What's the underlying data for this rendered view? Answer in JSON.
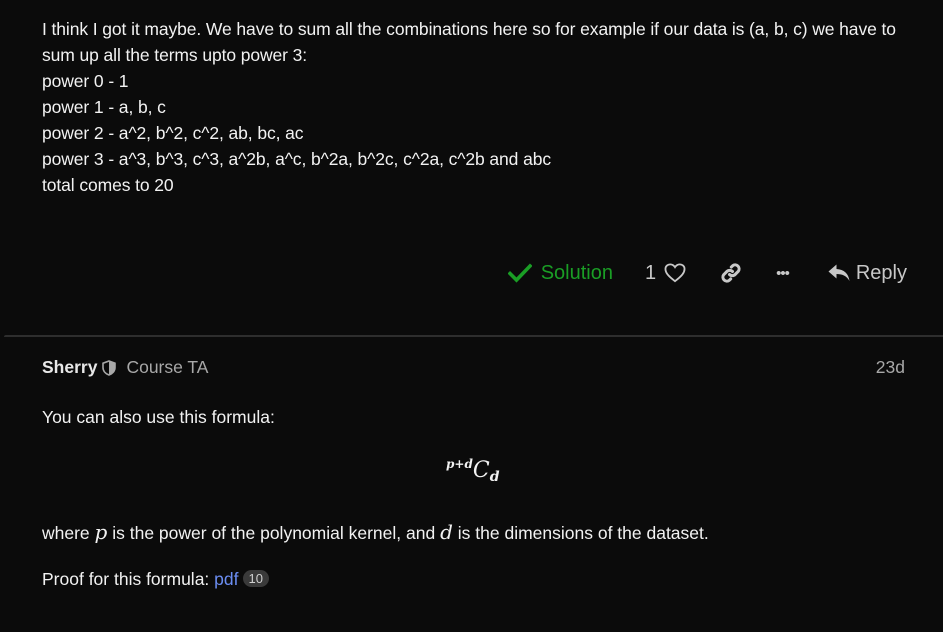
{
  "post1": {
    "lines": [
      "I think I got it maybe. We have to sum all the combinations here so for example if our data is (a, b, c) we have to sum up all the terms upto power 3:",
      "power 0 - 1",
      "power 1 - a, b, c",
      "power 2 - a^2, b^2, c^2, ab, bc, ac",
      "power 3 - a^3, b^3, c^3, a^2b, a^c, b^2a, b^2c, c^2a, c^2b and abc",
      "total comes to 20"
    ],
    "actions": {
      "solution_label": "Solution",
      "like_count": "1",
      "reply_label": "Reply",
      "more_label": "•••"
    },
    "colors": {
      "solution": "#1a9e25"
    }
  },
  "post2": {
    "author": "Sherry",
    "role": "Course TA",
    "date": "23d",
    "intro": "You can also use this formula:",
    "formula": {
      "sup": "p+d",
      "base": "C",
      "sub": "d"
    },
    "explain": {
      "part1": "where",
      "var_p": "p",
      "part2": "is the power of the polynomial kernel, and",
      "var_d": "d",
      "part3": "is the dimensions of the dataset."
    },
    "proof_label": "Proof for this formula:",
    "proof_link": "pdf",
    "proof_clicks": "10",
    "colors": {
      "link": "#6b8df2"
    }
  }
}
